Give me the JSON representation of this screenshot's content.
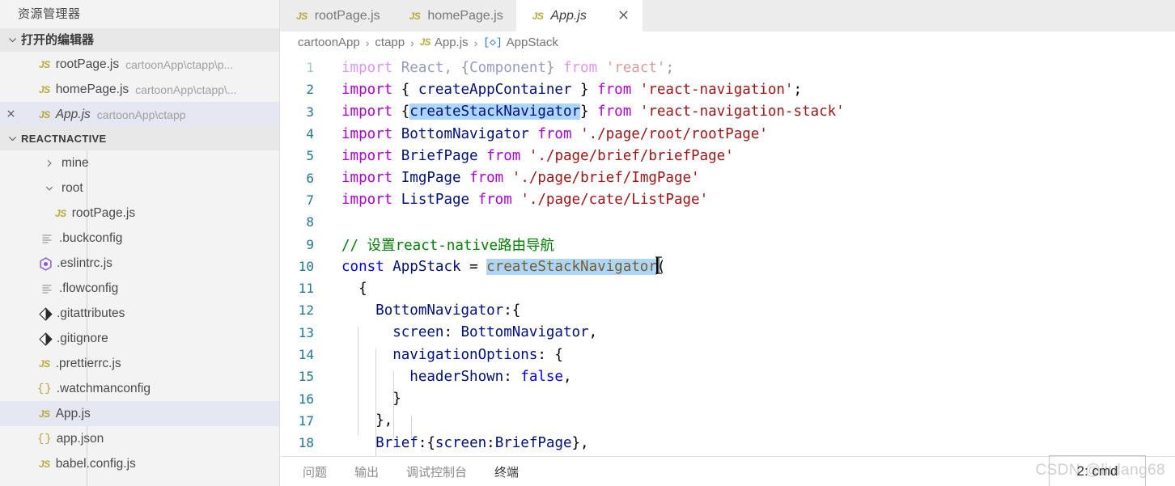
{
  "sidebar": {
    "title": "资源管理器",
    "open_editors": {
      "label": "打开的编辑器",
      "items": [
        {
          "icon": "js-file-icon",
          "name": "rootPage.js",
          "path": "cartoonApp\\ctapp\\p...",
          "selected": false,
          "has_close": false,
          "italic": false
        },
        {
          "icon": "js-file-icon",
          "name": "homePage.js",
          "path": "cartoonApp\\ctapp\\...",
          "selected": false,
          "has_close": false,
          "italic": false
        },
        {
          "icon": "js-file-icon",
          "name": "App.js",
          "path": "cartoonApp\\ctapp",
          "selected": true,
          "has_close": true,
          "italic": true
        }
      ]
    },
    "project": {
      "label": "REACTNACTIVE",
      "items": [
        {
          "icon": "chevron-right-icon",
          "kind": "folder",
          "name": "mine",
          "indent": 2,
          "expanded": false,
          "selected": false
        },
        {
          "icon": "chevron-down-icon",
          "kind": "folder",
          "name": "root",
          "indent": 2,
          "expanded": true,
          "selected": false
        },
        {
          "icon": "js-file-icon",
          "kind": "file",
          "name": "rootPage.js",
          "indent": 3,
          "selected": false
        },
        {
          "icon": "config-file-icon",
          "kind": "file",
          "name": ".buckconfig",
          "indent": 2,
          "selected": false
        },
        {
          "icon": "eslint-icon",
          "kind": "file",
          "name": ".eslintrc.js",
          "indent": 2,
          "selected": false
        },
        {
          "icon": "config-file-icon",
          "kind": "file",
          "name": ".flowconfig",
          "indent": 2,
          "selected": false
        },
        {
          "icon": "git-icon",
          "kind": "file",
          "name": ".gitattributes",
          "indent": 2,
          "selected": false
        },
        {
          "icon": "git-icon",
          "kind": "file",
          "name": ".gitignore",
          "indent": 2,
          "selected": false
        },
        {
          "icon": "js-file-icon",
          "kind": "file",
          "name": ".prettierrc.js",
          "indent": 2,
          "selected": false
        },
        {
          "icon": "json-file-icon",
          "kind": "file",
          "name": ".watchmanconfig",
          "indent": 2,
          "selected": false
        },
        {
          "icon": "js-file-icon",
          "kind": "file",
          "name": "App.js",
          "indent": 2,
          "selected": true
        },
        {
          "icon": "json-file-icon",
          "kind": "file",
          "name": "app.json",
          "indent": 2,
          "selected": false
        },
        {
          "icon": "js-file-icon",
          "kind": "file",
          "name": "babel.config.js",
          "indent": 2,
          "selected": false
        }
      ]
    }
  },
  "editor": {
    "tabs": [
      {
        "icon": "js-file-icon",
        "label": "rootPage.js",
        "active": false,
        "italic": false,
        "closable": false
      },
      {
        "icon": "js-file-icon",
        "label": "homePage.js",
        "active": false,
        "italic": false,
        "closable": false
      },
      {
        "icon": "js-file-icon",
        "label": "App.js",
        "active": true,
        "italic": true,
        "closable": true,
        "close_glyph": "✕"
      }
    ],
    "breadcrumb": [
      {
        "text": "cartoonApp",
        "icon": null
      },
      {
        "text": "ctapp",
        "icon": null
      },
      {
        "text": "App.js",
        "icon": "js-file-icon"
      },
      {
        "text": "AppStack",
        "icon": "symbol-variable-icon"
      }
    ],
    "breadcrumb_separator": "›",
    "code": {
      "first_line_number": 1,
      "lines": [
        {
          "n": 1,
          "dim": true,
          "tokens": [
            {
              "t": "import",
              "c": "kw"
            },
            {
              "t": " React, ",
              "c": "ident"
            },
            {
              "t": "{",
              "c": "punct"
            },
            {
              "t": "Component",
              "c": "ident"
            },
            {
              "t": "}",
              "c": "punct"
            },
            {
              "t": " ",
              "c": "punct"
            },
            {
              "t": "from",
              "c": "kw"
            },
            {
              "t": " ",
              "c": "punct"
            },
            {
              "t": "'react'",
              "c": "str"
            },
            {
              "t": ";",
              "c": "punct"
            }
          ]
        },
        {
          "n": 2,
          "dim": false,
          "tokens": [
            {
              "t": "import",
              "c": "kw"
            },
            {
              "t": " { ",
              "c": "punct"
            },
            {
              "t": "createAppContainer",
              "c": "ident"
            },
            {
              "t": " } ",
              "c": "punct"
            },
            {
              "t": "from",
              "c": "kw"
            },
            {
              "t": " ",
              "c": "punct"
            },
            {
              "t": "'react-navigation'",
              "c": "str"
            },
            {
              "t": ";",
              "c": "punct"
            }
          ]
        },
        {
          "n": 3,
          "dim": false,
          "tokens": [
            {
              "t": "import",
              "c": "kw"
            },
            {
              "t": " {",
              "c": "punct"
            },
            {
              "t": "createStackNavigator",
              "c": "ident sel"
            },
            {
              "t": "}",
              "c": "punct"
            },
            {
              "t": " ",
              "c": "punct"
            },
            {
              "t": "from",
              "c": "kw"
            },
            {
              "t": " ",
              "c": "punct"
            },
            {
              "t": "'react-navigation-stack'",
              "c": "str"
            }
          ]
        },
        {
          "n": 4,
          "dim": false,
          "tokens": [
            {
              "t": "import",
              "c": "kw"
            },
            {
              "t": " ",
              "c": "punct"
            },
            {
              "t": "BottomNavigator",
              "c": "ident"
            },
            {
              "t": " ",
              "c": "punct"
            },
            {
              "t": "from",
              "c": "kw"
            },
            {
              "t": " ",
              "c": "punct"
            },
            {
              "t": "'./page/root/rootPage'",
              "c": "str"
            }
          ]
        },
        {
          "n": 5,
          "dim": false,
          "tokens": [
            {
              "t": "import",
              "c": "kw"
            },
            {
              "t": " ",
              "c": "punct"
            },
            {
              "t": "BriefPage",
              "c": "ident"
            },
            {
              "t": " ",
              "c": "punct"
            },
            {
              "t": "from",
              "c": "kw"
            },
            {
              "t": " ",
              "c": "punct"
            },
            {
              "t": "'./page/brief/briefPage'",
              "c": "str"
            }
          ]
        },
        {
          "n": 6,
          "dim": false,
          "tokens": [
            {
              "t": "import",
              "c": "kw"
            },
            {
              "t": " ",
              "c": "punct"
            },
            {
              "t": "ImgPage",
              "c": "ident"
            },
            {
              "t": " ",
              "c": "punct"
            },
            {
              "t": "from",
              "c": "kw"
            },
            {
              "t": " ",
              "c": "punct"
            },
            {
              "t": "'./page/brief/ImgPage'",
              "c": "str"
            }
          ]
        },
        {
          "n": 7,
          "dim": false,
          "tokens": [
            {
              "t": "import",
              "c": "kw"
            },
            {
              "t": " ",
              "c": "punct"
            },
            {
              "t": "ListPage",
              "c": "ident"
            },
            {
              "t": " ",
              "c": "punct"
            },
            {
              "t": "from",
              "c": "kw"
            },
            {
              "t": " ",
              "c": "punct"
            },
            {
              "t": "'./page/cate/ListPage'",
              "c": "str"
            }
          ]
        },
        {
          "n": 8,
          "dim": false,
          "tokens": []
        },
        {
          "n": 9,
          "dim": false,
          "tokens": [
            {
              "t": "// 设置react-native路由导航",
              "c": "cmt"
            }
          ]
        },
        {
          "n": 10,
          "dim": false,
          "tokens": [
            {
              "t": "const",
              "c": "kw2"
            },
            {
              "t": " ",
              "c": "punct"
            },
            {
              "t": "AppStack",
              "c": "ident"
            },
            {
              "t": " = ",
              "c": "punct"
            },
            {
              "t": "createStackNavigator",
              "c": "func sel"
            },
            {
              "t": "(",
              "c": "punct"
            }
          ]
        },
        {
          "n": 11,
          "dim": false,
          "tokens": [
            {
              "t": "  {",
              "c": "punct"
            }
          ]
        },
        {
          "n": 12,
          "dim": false,
          "tokens": [
            {
              "t": "    ",
              "c": "punct"
            },
            {
              "t": "BottomNavigator",
              "c": "prop"
            },
            {
              "t": ":{",
              "c": "punct"
            }
          ]
        },
        {
          "n": 13,
          "dim": false,
          "tokens": [
            {
              "t": "      ",
              "c": "punct"
            },
            {
              "t": "screen",
              "c": "prop"
            },
            {
              "t": ": ",
              "c": "punct"
            },
            {
              "t": "BottomNavigator",
              "c": "prop"
            },
            {
              "t": ",",
              "c": "punct"
            }
          ]
        },
        {
          "n": 14,
          "dim": false,
          "tokens": [
            {
              "t": "      ",
              "c": "punct"
            },
            {
              "t": "navigationOptions",
              "c": "prop"
            },
            {
              "t": ": {",
              "c": "punct"
            }
          ]
        },
        {
          "n": 15,
          "dim": false,
          "tokens": [
            {
              "t": "        ",
              "c": "punct"
            },
            {
              "t": "headerShown",
              "c": "prop"
            },
            {
              "t": ": ",
              "c": "punct"
            },
            {
              "t": "false",
              "c": "kw2"
            },
            {
              "t": ",",
              "c": "punct"
            }
          ]
        },
        {
          "n": 16,
          "dim": false,
          "tokens": [
            {
              "t": "      }",
              "c": "punct"
            }
          ]
        },
        {
          "n": 17,
          "dim": false,
          "tokens": [
            {
              "t": "    },",
              "c": "punct"
            }
          ]
        },
        {
          "n": 18,
          "dim": false,
          "tokens": [
            {
              "t": "    ",
              "c": "punct"
            },
            {
              "t": "Brief",
              "c": "prop"
            },
            {
              "t": ":{",
              "c": "punct"
            },
            {
              "t": "screen",
              "c": "prop"
            },
            {
              "t": ":",
              "c": "punct"
            },
            {
              "t": "BriefPage",
              "c": "prop"
            },
            {
              "t": "},",
              "c": "punct"
            }
          ]
        }
      ]
    }
  },
  "panel": {
    "tabs": [
      {
        "label": "问题",
        "active": false
      },
      {
        "label": "输出",
        "active": false
      },
      {
        "label": "调试控制台",
        "active": false
      },
      {
        "label": "终端",
        "active": true
      }
    ],
    "terminal_selector": "2: cmd"
  },
  "watermark": "CSDN @liulang68",
  "colors": {
    "sidebar_bg": "#f3f3f3",
    "section_header_bg": "#e7e7e7",
    "selected_row_bg": "#e4e6f1",
    "tab_inactive_bg": "#ececec",
    "tab_active_bg": "#ffffff",
    "editor_bg": "#ffffff",
    "line_number": "#237893",
    "keyword": "#af00db",
    "keyword_blue": "#0000ff",
    "string": "#a31515",
    "identifier": "#001080",
    "comment": "#008000",
    "function": "#795e26",
    "selection": "#add6ff",
    "js_icon": "#b7a93a"
  }
}
